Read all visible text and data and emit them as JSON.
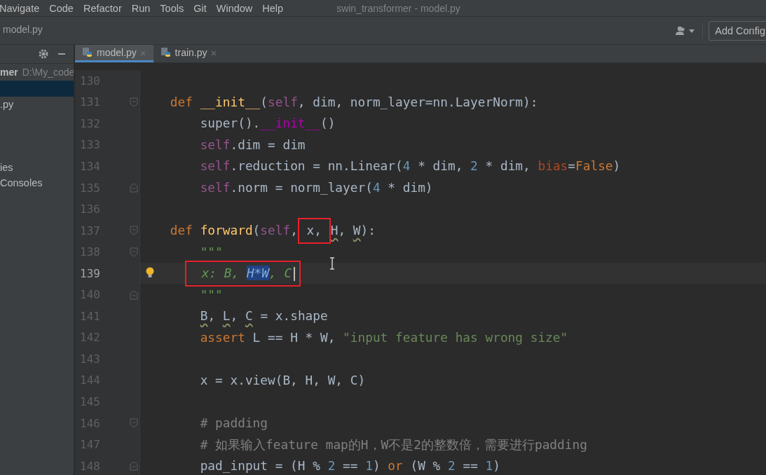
{
  "window": {
    "title": "swin_transformer - model.py"
  },
  "menu": [
    "Navigate",
    "Code",
    "Refactor",
    "Run",
    "Tools",
    "Git",
    "Window",
    "Help"
  ],
  "toolbar": {
    "breadcrumb": "model.py",
    "run_config": "Add Config"
  },
  "project": {
    "root_name": "mer",
    "root_path": "D:\\My_code",
    "items": [
      {
        "selected": true
      },
      {
        "label": ".py",
        "selected": false
      },
      {
        "selected": false
      },
      {
        "selected": false
      },
      {
        "selected": false
      },
      {
        "label": "ies",
        "selected": false
      },
      {
        "label": "Consoles",
        "selected": false
      }
    ]
  },
  "tabs": [
    {
      "label": "model.py",
      "close": "×",
      "selected": true
    },
    {
      "label": "train.py",
      "close": "×",
      "selected": false
    }
  ],
  "editor": {
    "lines": [
      {
        "number": "130",
        "current": false,
        "bulb": false,
        "fold_start": false,
        "fold_end": false
      },
      {
        "number": "131",
        "current": false,
        "bulb": false,
        "fold_start": true,
        "fold_end": false,
        "tokens": [
          {
            "text": "    def ",
            "kind": "keyword"
          },
          {
            "text": "__init__",
            "kind": "function"
          },
          {
            "text": "(",
            "kind": "plain"
          },
          {
            "text": "self",
            "kind": "self"
          },
          {
            "text": ", dim, norm_layer=nn.LayerNorm):",
            "kind": "plain"
          }
        ]
      },
      {
        "number": "132",
        "current": false,
        "bulb": false,
        "fold_start": false,
        "fold_end": false,
        "tokens": [
          {
            "text": "        super().",
            "kind": "plain"
          },
          {
            "text": "__init__",
            "kind": "magic"
          },
          {
            "text": "()",
            "kind": "plain"
          }
        ]
      },
      {
        "number": "133",
        "current": false,
        "bulb": false,
        "fold_start": false,
        "fold_end": false,
        "tokens": [
          {
            "text": "        self",
            "kind": "self"
          },
          {
            "text": ".dim = dim",
            "kind": "plain"
          }
        ]
      },
      {
        "number": "134",
        "current": false,
        "bulb": false,
        "fold_start": false,
        "fold_end": false,
        "tokens": [
          {
            "text": "        self",
            "kind": "self"
          },
          {
            "text": ".reduction = nn.Linear(",
            "kind": "plain"
          },
          {
            "text": "4",
            "kind": "number"
          },
          {
            "text": " * dim, ",
            "kind": "plain"
          },
          {
            "text": "2",
            "kind": "number"
          },
          {
            "text": " * dim, ",
            "kind": "plain"
          },
          {
            "text": "bias",
            "kind": "named"
          },
          {
            "text": "=",
            "kind": "plain"
          },
          {
            "text": "False",
            "kind": "keyword"
          },
          {
            "text": ")",
            "kind": "plain"
          }
        ]
      },
      {
        "number": "135",
        "current": false,
        "bulb": false,
        "fold_start": false,
        "fold_end": true,
        "tokens": [
          {
            "text": "        self",
            "kind": "self"
          },
          {
            "text": ".norm = norm_layer(",
            "kind": "plain"
          },
          {
            "text": "4",
            "kind": "number"
          },
          {
            "text": " * dim)",
            "kind": "plain"
          }
        ]
      },
      {
        "number": "136",
        "current": false,
        "bulb": false,
        "fold_start": false,
        "fold_end": false
      },
      {
        "number": "137",
        "current": false,
        "bulb": false,
        "fold_start": true,
        "fold_end": false,
        "tokens": [
          {
            "text": "    def ",
            "kind": "keyword"
          },
          {
            "text": "forward",
            "kind": "function"
          },
          {
            "text": "(",
            "kind": "plain"
          },
          {
            "text": "self",
            "kind": "self"
          },
          {
            "text": ",",
            "kind": "plain"
          },
          {
            "kind": "box",
            "parts": [
              {
                "text": " x, ",
                "kind": "plain"
              }
            ]
          },
          {
            "text": "H",
            "kind": "warn"
          },
          {
            "text": ", ",
            "kind": "plain"
          },
          {
            "text": "W",
            "kind": "warn"
          },
          {
            "text": "):",
            "kind": "plain"
          }
        ]
      },
      {
        "number": "138",
        "current": false,
        "bulb": false,
        "fold_start": true,
        "fold_end": false,
        "tokens": [
          {
            "text": "        \"\"\"",
            "kind": "doc"
          }
        ]
      },
      {
        "number": "139",
        "current": true,
        "bulb": true,
        "fold_start": false,
        "fold_end": false,
        "tokens": [
          {
            "kind": "box",
            "parts": [
              {
                "text": "  x: B, ",
                "kind": "doc"
              },
              {
                "text": "H*W",
                "kind": "selection"
              },
              {
                "text": ", C ",
                "kind": "doc"
              }
            ]
          }
        ]
      },
      {
        "number": "140",
        "current": false,
        "bulb": false,
        "fold_start": false,
        "fold_end": true,
        "tokens": [
          {
            "text": "        \"\"\"",
            "kind": "doc"
          }
        ]
      },
      {
        "number": "141",
        "current": false,
        "bulb": false,
        "fold_start": false,
        "fold_end": false,
        "tokens": [
          {
            "text": "        B",
            "kind": "warn"
          },
          {
            "text": ", ",
            "kind": "plain"
          },
          {
            "text": "L",
            "kind": "warn"
          },
          {
            "text": ", ",
            "kind": "plain"
          },
          {
            "text": "C",
            "kind": "warn"
          },
          {
            "text": " = x.shape",
            "kind": "plain"
          }
        ]
      },
      {
        "number": "142",
        "current": false,
        "bulb": false,
        "fold_start": false,
        "fold_end": false,
        "tokens": [
          {
            "text": "        assert",
            "kind": "keyword"
          },
          {
            "text": " L == H * W, ",
            "kind": "plain"
          },
          {
            "text": "\"input feature has wrong size\"",
            "kind": "string"
          }
        ]
      },
      {
        "number": "143",
        "current": false,
        "bulb": false,
        "fold_start": false,
        "fold_end": false
      },
      {
        "number": "144",
        "current": false,
        "bulb": false,
        "fold_start": false,
        "fold_end": false,
        "tokens": [
          {
            "text": "        x = x.view(B, H, W, C)",
            "kind": "plain"
          }
        ]
      },
      {
        "number": "145",
        "current": false,
        "bulb": false,
        "fold_start": false,
        "fold_end": false
      },
      {
        "number": "146",
        "current": false,
        "bulb": false,
        "fold_start": true,
        "fold_end": false,
        "tokens": [
          {
            "text": "        # padding",
            "kind": "comment"
          }
        ]
      },
      {
        "number": "147",
        "current": false,
        "bulb": false,
        "fold_start": false,
        "fold_end": false,
        "tokens": [
          {
            "text": "        # 如果输入feature map的H，W不是2的整数倍，需要进行padding",
            "kind": "comment"
          }
        ]
      },
      {
        "number": "148",
        "current": false,
        "bulb": false,
        "fold_start": false,
        "fold_end": true,
        "tokens": [
          {
            "text": "        pad_input = (H % ",
            "kind": "plain"
          },
          {
            "text": "2",
            "kind": "number"
          },
          {
            "text": " == ",
            "kind": "plain"
          },
          {
            "text": "1",
            "kind": "number"
          },
          {
            "text": ") ",
            "kind": "plain"
          },
          {
            "text": "or",
            "kind": "keyword"
          },
          {
            "text": " (W % ",
            "kind": "plain"
          },
          {
            "text": "2",
            "kind": "number"
          },
          {
            "text": " == ",
            "kind": "plain"
          },
          {
            "text": "1",
            "kind": "number"
          },
          {
            "text": ")",
            "kind": "plain"
          }
        ]
      }
    ]
  }
}
